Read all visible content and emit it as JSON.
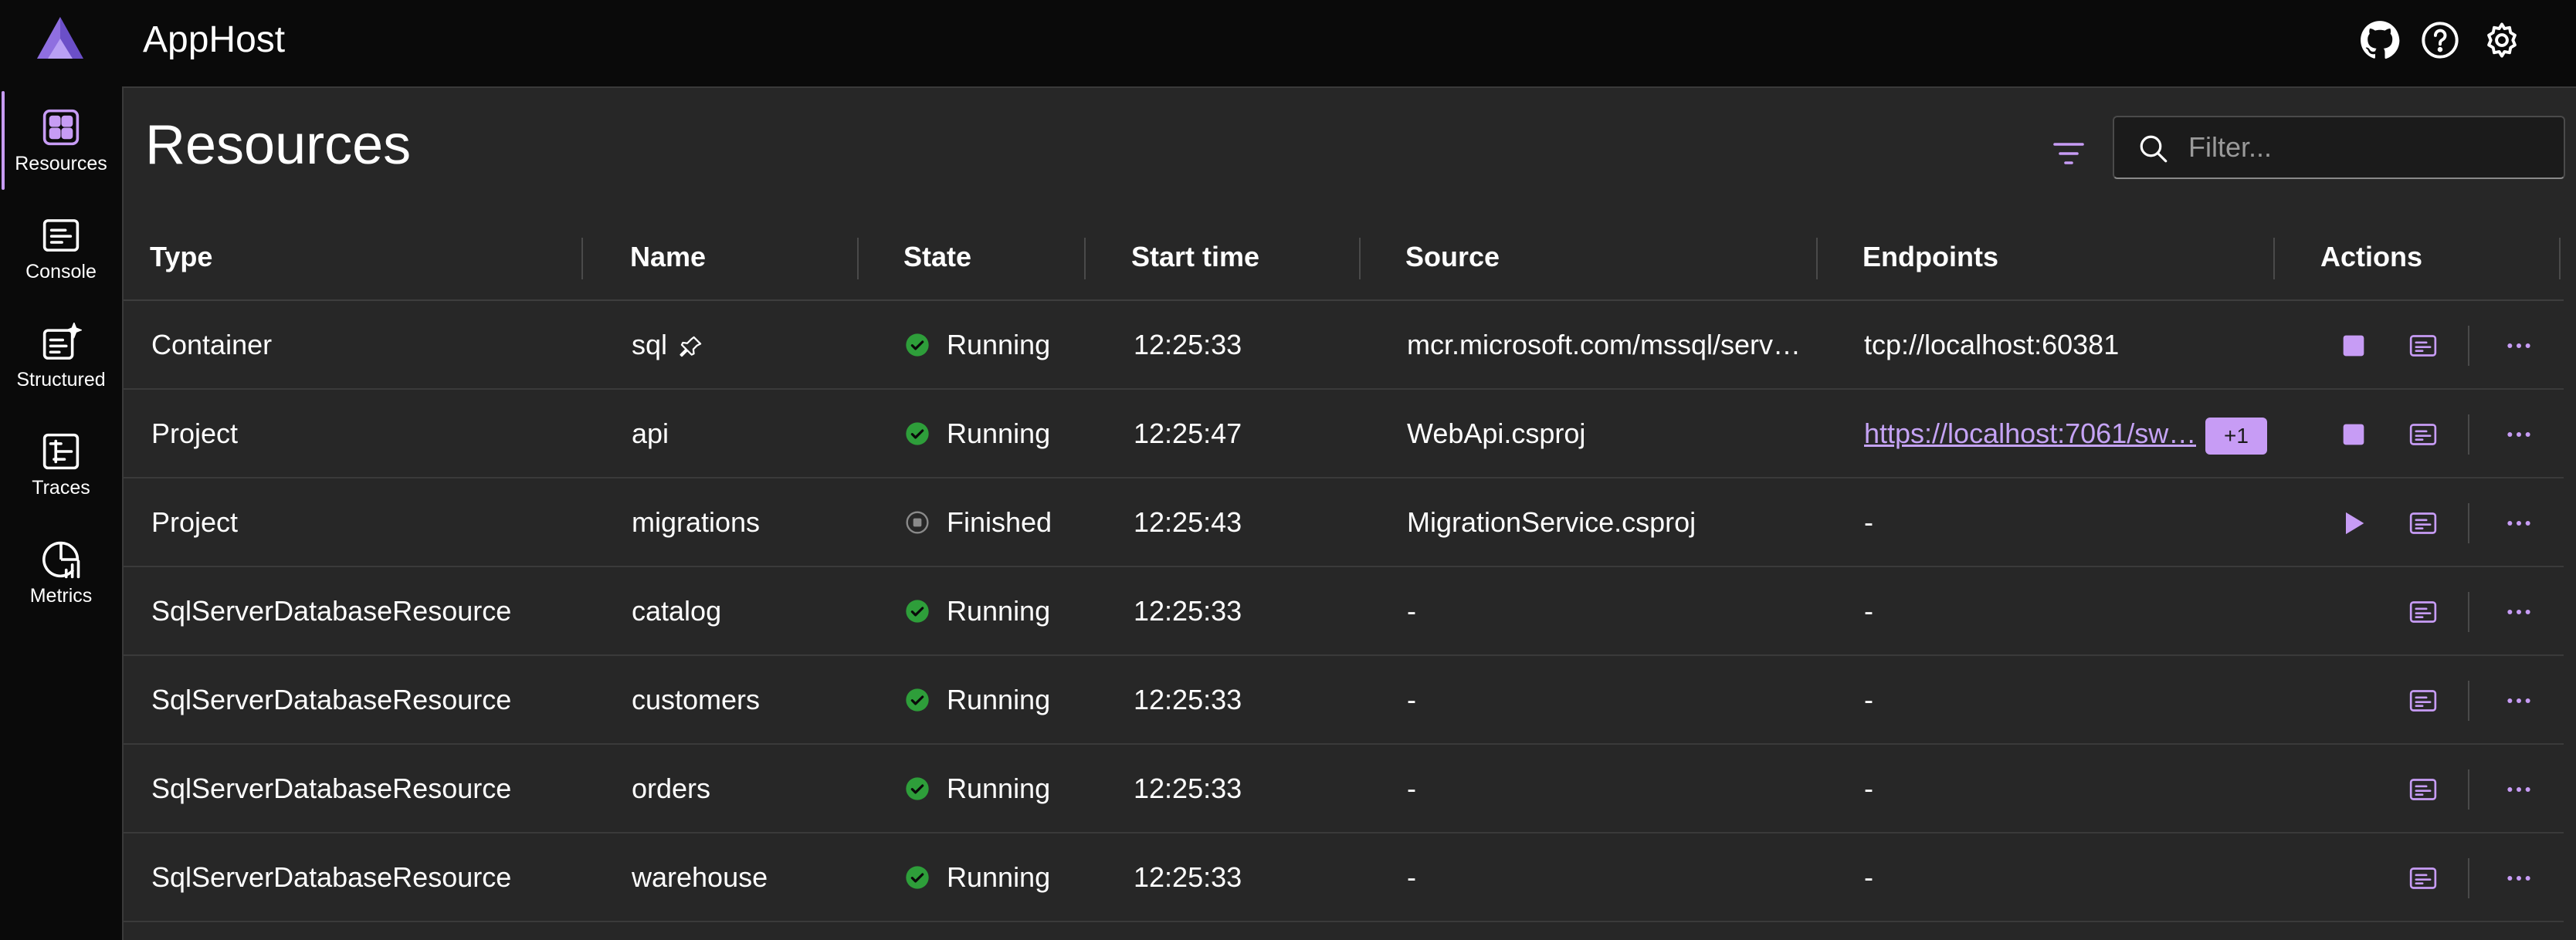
{
  "app": {
    "title": "AppHost"
  },
  "colors": {
    "accent": "#c79cf5",
    "running": "#2e9e3a",
    "finished": "#8a8a8a",
    "link": "#c5a3f5"
  },
  "header_icons": [
    "github-icon",
    "help-icon",
    "settings-icon"
  ],
  "nav": {
    "items": [
      {
        "label": "Resources",
        "icon": "resources-icon",
        "active": true
      },
      {
        "label": "Console",
        "icon": "console-icon",
        "active": false
      },
      {
        "label": "Structured",
        "icon": "structured-icon",
        "active": false
      },
      {
        "label": "Traces",
        "icon": "traces-icon",
        "active": false
      },
      {
        "label": "Metrics",
        "icon": "metrics-icon",
        "active": false
      }
    ]
  },
  "page": {
    "title": "Resources",
    "filter_placeholder": "Filter..."
  },
  "table": {
    "columns": [
      "Type",
      "Name",
      "State",
      "Start time",
      "Source",
      "Endpoints",
      "Actions"
    ],
    "rows": [
      {
        "type": "Container",
        "name": "sql",
        "pinned": true,
        "state": "Running",
        "start": "12:25:33",
        "source": "mcr.microsoft.com/mssql/serv…",
        "endpoint": "tcp://localhost:60381",
        "endpoint_link": false,
        "extra": "",
        "primary_action": "stop"
      },
      {
        "type": "Project",
        "name": "api",
        "pinned": false,
        "state": "Running",
        "start": "12:25:47",
        "source": "WebApi.csproj",
        "endpoint": "https://localhost:7061/sw…",
        "endpoint_link": true,
        "extra": "+1",
        "primary_action": "stop"
      },
      {
        "type": "Project",
        "name": "migrations",
        "pinned": false,
        "state": "Finished",
        "start": "12:25:43",
        "source": "MigrationService.csproj",
        "endpoint": "-",
        "endpoint_link": false,
        "extra": "",
        "primary_action": "start"
      },
      {
        "type": "SqlServerDatabaseResource",
        "name": "catalog",
        "pinned": false,
        "state": "Running",
        "start": "12:25:33",
        "source": "-",
        "endpoint": "-",
        "endpoint_link": false,
        "extra": "",
        "primary_action": ""
      },
      {
        "type": "SqlServerDatabaseResource",
        "name": "customers",
        "pinned": false,
        "state": "Running",
        "start": "12:25:33",
        "source": "-",
        "endpoint": "-",
        "endpoint_link": false,
        "extra": "",
        "primary_action": ""
      },
      {
        "type": "SqlServerDatabaseResource",
        "name": "orders",
        "pinned": false,
        "state": "Running",
        "start": "12:25:33",
        "source": "-",
        "endpoint": "-",
        "endpoint_link": false,
        "extra": "",
        "primary_action": ""
      },
      {
        "type": "SqlServerDatabaseResource",
        "name": "warehouse",
        "pinned": false,
        "state": "Running",
        "start": "12:25:33",
        "source": "-",
        "endpoint": "-",
        "endpoint_link": false,
        "extra": "",
        "primary_action": ""
      }
    ]
  }
}
